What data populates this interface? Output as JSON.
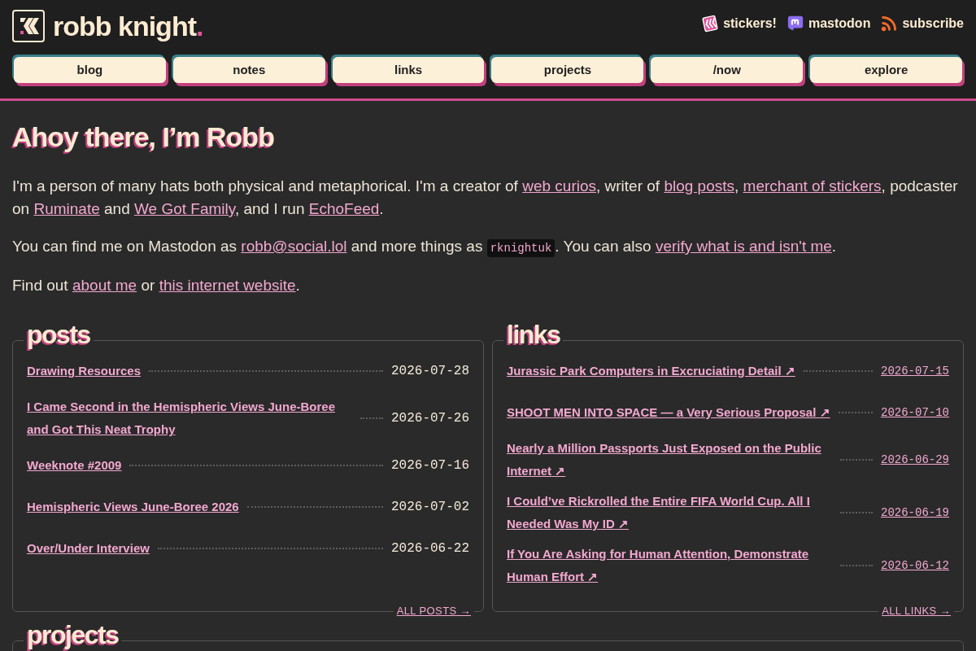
{
  "header": {
    "site_title": "robb knight",
    "title_dot": ".",
    "links": [
      {
        "label": "stickers!"
      },
      {
        "label": "mastodon"
      },
      {
        "label": "subscribe"
      }
    ]
  },
  "nav": [
    "blog",
    "notes",
    "links",
    "projects",
    "/now",
    "explore"
  ],
  "intro": {
    "heading": "Ahoy there, I’m Robb",
    "paragraphs": [
      [
        {
          "kind": "text",
          "text": "I'm a person of many hats both physical and metaphorical. I'm a creator of "
        },
        {
          "kind": "link",
          "text": "web curios"
        },
        {
          "kind": "text",
          "text": ", writer of "
        },
        {
          "kind": "link",
          "text": "blog posts"
        },
        {
          "kind": "text",
          "text": ", "
        },
        {
          "kind": "link",
          "text": "merchant of stickers"
        },
        {
          "kind": "text",
          "text": ", podcaster on "
        },
        {
          "kind": "link",
          "text": "Ruminate"
        },
        {
          "kind": "text",
          "text": " and "
        },
        {
          "kind": "link",
          "text": "We Got Family"
        },
        {
          "kind": "text",
          "text": ", and I run "
        },
        {
          "kind": "link",
          "text": "EchoFeed"
        },
        {
          "kind": "text",
          "text": "."
        }
      ],
      [
        {
          "kind": "text",
          "text": "You can find me on Mastodon as "
        },
        {
          "kind": "link",
          "text": "robb@social.lol"
        },
        {
          "kind": "text",
          "text": " and more things as "
        },
        {
          "kind": "code",
          "text": "rknightuk"
        },
        {
          "kind": "text",
          "text": ". You can also "
        },
        {
          "kind": "link",
          "text": "verify what is and isn't me"
        },
        {
          "kind": "text",
          "text": "."
        }
      ],
      [
        {
          "kind": "text",
          "text": "Find out "
        },
        {
          "kind": "link",
          "text": "about me"
        },
        {
          "kind": "text",
          "text": " or "
        },
        {
          "kind": "link",
          "text": "this internet website"
        },
        {
          "kind": "text",
          "text": "."
        }
      ]
    ]
  },
  "sections": [
    {
      "kind": "posts",
      "title": "posts",
      "items": [
        {
          "title": "Drawing Resources",
          "date": "2026-07-28"
        },
        {
          "title": "I Came Second in the Hemispheric Views June-Boree and Got This Neat Trophy",
          "date": "2026-07-26"
        },
        {
          "title": "Weeknote #2009",
          "date": "2026-07-16"
        },
        {
          "title": "Hemispheric Views June-Boree 2026",
          "date": "2026-07-02"
        },
        {
          "title": "Over/Under Interview",
          "date": "2026-06-22"
        }
      ],
      "more": "ALL POSTS →"
    },
    {
      "kind": "links",
      "title": "links",
      "items": [
        {
          "title": "Jurassic Park Computers in Excruciating Detail ↗",
          "date": "2026-07-15"
        },
        {
          "title": "SHOOT MEN INTO SPACE — a Very Serious Proposal ↗",
          "date": "2026-07-10"
        },
        {
          "title": "Nearly a Million Passports Just Exposed on the Public Internet ↗",
          "date": "2026-06-29"
        },
        {
          "title": "I Could’ve Rickrolled the Entire FIFA World Cup. All I Needed Was My ID ↗",
          "date": "2026-06-19"
        },
        {
          "title": "If You Are Asking for Human Attention, Demonstrate Human Effort ↗",
          "date": "2026-06-12"
        }
      ],
      "more": "ALL LINKS →"
    },
    {
      "kind": "projects",
      "title": "projects"
    }
  ]
}
